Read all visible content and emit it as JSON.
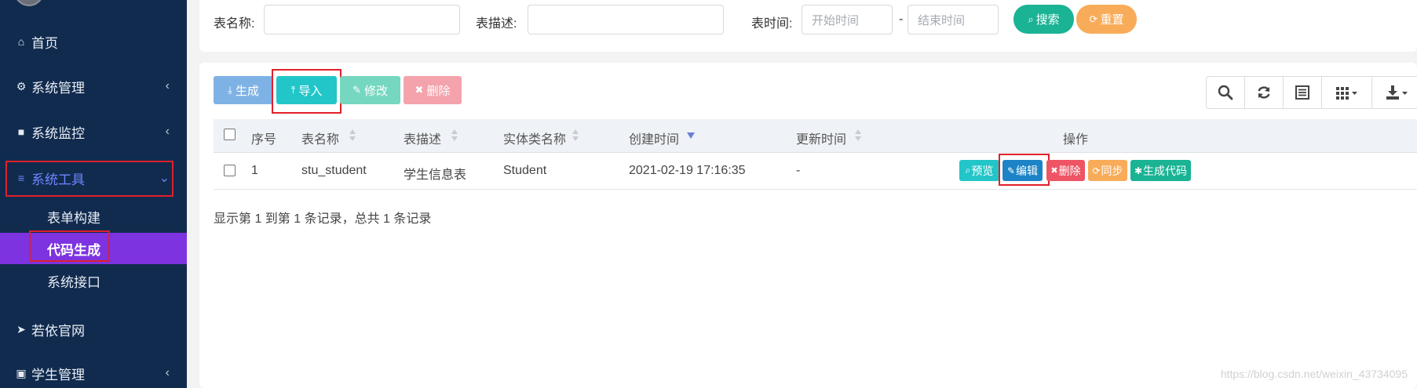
{
  "sidebar": {
    "items": [
      {
        "icon": "home-icon",
        "glyph": "⌂",
        "label": "首页"
      },
      {
        "icon": "gear-icon",
        "glyph": "⚙",
        "label": "系统管理",
        "chevron": "‹"
      },
      {
        "icon": "video-icon",
        "glyph": "■",
        "label": "系统监控",
        "chevron": "‹"
      },
      {
        "icon": "list-icon",
        "glyph": "≡",
        "label": "系统工具",
        "chevron": "⌄"
      },
      {
        "icon": "send-icon",
        "glyph": "➤",
        "label": "若依官网"
      },
      {
        "icon": "id-card-icon",
        "glyph": "▣",
        "label": "学生管理",
        "chevron": "‹"
      }
    ],
    "sub_items": [
      {
        "label": "表单构建"
      },
      {
        "label": "代码生成",
        "active": true
      },
      {
        "label": "系统接口"
      }
    ]
  },
  "search": {
    "table_name_label": "表名称:",
    "table_desc_label": "表描述:",
    "table_time_label": "表时间:",
    "start_placeholder": "开始时间",
    "end_placeholder": "结束时间",
    "range_sep": "-",
    "search_label": "搜索",
    "reset_label": "重置"
  },
  "toolbar": {
    "generate_label": "生成",
    "import_label": "导入",
    "edit_label": "修改",
    "delete_label": "删除"
  },
  "table": {
    "headers": [
      "序号",
      "表名称",
      "表描述",
      "实体类名称",
      "创建时间",
      "更新时间",
      "操作"
    ],
    "rows": [
      {
        "index": "1",
        "name": "stu_student",
        "desc": "学生信息表",
        "entity": "Student",
        "created": "2021-02-19 17:16:35",
        "updated": "-"
      }
    ],
    "actions": {
      "preview": "预览",
      "edit": "编辑",
      "delete": "删除",
      "sync": "同步",
      "gen": "生成代码"
    },
    "summary": "显示第 1 到第 1 条记录，总共 1 条记录"
  },
  "watermark": "https://blog.csdn.net/weixin_43734095",
  "colors": {
    "sidebar_bg": "#112b4f",
    "active_menu": "#7d33e0",
    "primary_teal": "#1ab394",
    "warning": "#f8ac59",
    "info": "#23c6c8",
    "danger": "#ed5565",
    "edit_blue": "#1c84c6",
    "highlight_red": "#e0202a"
  }
}
